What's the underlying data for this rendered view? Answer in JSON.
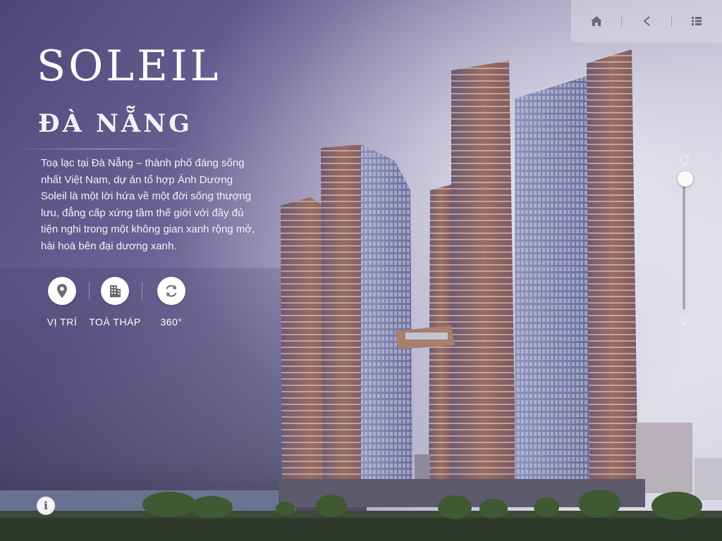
{
  "header": {
    "title": "SOLEIL",
    "subtitle": "ĐÀ NẴNG"
  },
  "description": "Toạ lạc tại Đà Nẵng – thành phố đáng sống nhất Việt Nam, dự án tổ hợp Ánh Dương Soleil là một lời hứa về một đời sống thượng lưu, đẳng cấp xứng tầm thế giới với đầy đủ tiện nghi trong một không gian xanh rộng mở, hài hoà bên đại dương xanh.",
  "actions": [
    {
      "label": "VỊ TRÍ",
      "icon": "location-pin-icon"
    },
    {
      "label": "TOÀ THÁP",
      "icon": "building-icon"
    },
    {
      "label": "360°",
      "icon": "rotate-icon"
    }
  ],
  "topbar": {
    "icons": [
      "home-icon",
      "back-icon",
      "menu-list-icon"
    ]
  },
  "slider": {
    "value": 1.0,
    "top_icon": "bulb-off-icon",
    "bottom_icon": "bulb-on-icon"
  },
  "info": {
    "label": "i"
  },
  "colors": {
    "sky": "#6a5f92",
    "tower": "#8a5f58",
    "text": "#ffffff",
    "icon": "#6b6b72"
  }
}
